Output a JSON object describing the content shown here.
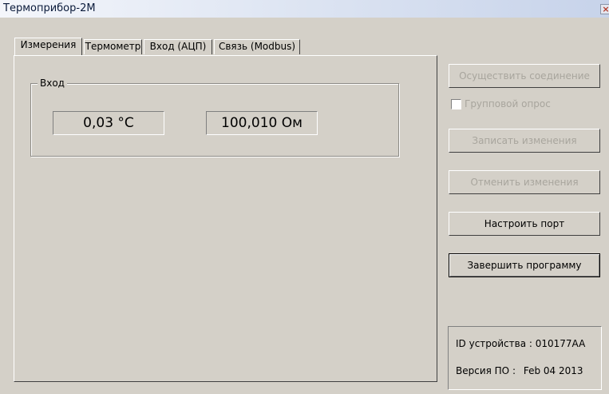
{
  "window": {
    "title": "Термоприбор-2М",
    "close_glyph": "×"
  },
  "tabs": [
    {
      "label": "Измерения",
      "active": true
    },
    {
      "label": "Термометр",
      "active": false
    },
    {
      "label": "Вход (АЦП)",
      "active": false
    },
    {
      "label": "Связь (Modbus)",
      "active": false
    }
  ],
  "measurements": {
    "group_label": "Вход",
    "temperature": "0,03 °С",
    "resistance": "100,010 Ом"
  },
  "actions": {
    "connect": "Осуществить соединение",
    "group_poll": "Групповой опрос",
    "write_changes": "Записать изменения",
    "cancel_changes": "Отменить изменения",
    "setup_port": "Настроить порт",
    "exit": "Завершить программу"
  },
  "device_info": {
    "id_label": "ID устройства :",
    "id_value": "010177AA",
    "version_label": "Версия ПО :",
    "version_value": "Feb 04 2013"
  }
}
